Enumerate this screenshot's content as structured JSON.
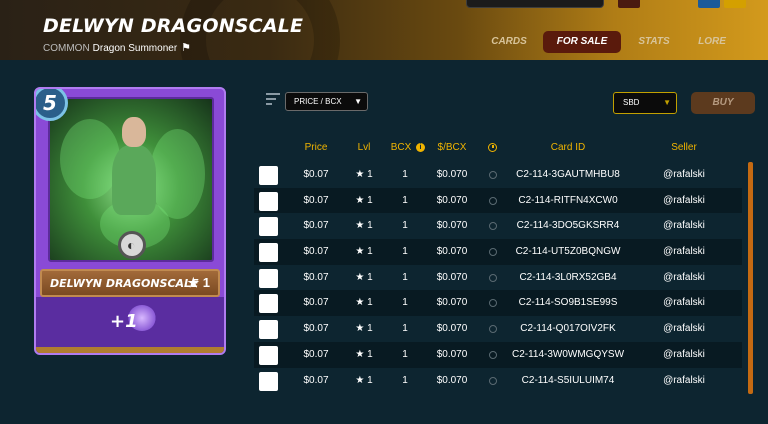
{
  "header": {
    "title": "DELWYN DRAGONSCALE",
    "rarity": "COMMON",
    "type": "Dragon Summoner",
    "tabs": [
      "CARDS",
      "FOR SALE",
      "STATS",
      "LORE"
    ],
    "active_tab": "FOR SALE"
  },
  "card": {
    "mana": "5",
    "name": "DELWYN DRAGONSCALE",
    "level_star": "★ 1",
    "ability": "+1"
  },
  "controls": {
    "sort_value": "PRICE / BCX",
    "currency_value": "SBD",
    "buy_label": "BUY"
  },
  "table": {
    "headers": {
      "price": "Price",
      "lvl": "Lvl",
      "bcx": "BCX",
      "per_bcx": "$/BCX",
      "card_id": "Card ID",
      "seller": "Seller"
    },
    "rows": [
      {
        "price": "$0.07",
        "lvl": "★ 1",
        "bcx": "1",
        "per_bcx": "$0.070",
        "card_id": "C2-114-3GAUTMHBU8",
        "seller": "@rafalski"
      },
      {
        "price": "$0.07",
        "lvl": "★ 1",
        "bcx": "1",
        "per_bcx": "$0.070",
        "card_id": "C2-114-RITFN4XCW0",
        "seller": "@rafalski"
      },
      {
        "price": "$0.07",
        "lvl": "★ 1",
        "bcx": "1",
        "per_bcx": "$0.070",
        "card_id": "C2-114-3DO5GKSRR4",
        "seller": "@rafalski"
      },
      {
        "price": "$0.07",
        "lvl": "★ 1",
        "bcx": "1",
        "per_bcx": "$0.070",
        "card_id": "C2-114-UT5Z0BQNGW",
        "seller": "@rafalski"
      },
      {
        "price": "$0.07",
        "lvl": "★ 1",
        "bcx": "1",
        "per_bcx": "$0.070",
        "card_id": "C2-114-3L0RX52GB4",
        "seller": "@rafalski"
      },
      {
        "price": "$0.07",
        "lvl": "★ 1",
        "bcx": "1",
        "per_bcx": "$0.070",
        "card_id": "C2-114-SO9B1SE99S",
        "seller": "@rafalski"
      },
      {
        "price": "$0.07",
        "lvl": "★ 1",
        "bcx": "1",
        "per_bcx": "$0.070",
        "card_id": "C2-114-Q017OIV2FK",
        "seller": "@rafalski"
      },
      {
        "price": "$0.07",
        "lvl": "★ 1",
        "bcx": "1",
        "per_bcx": "$0.070",
        "card_id": "C2-114-3W0WMGQYSW",
        "seller": "@rafalski"
      },
      {
        "price": "$0.07",
        "lvl": "★ 1",
        "bcx": "1",
        "per_bcx": "$0.070",
        "card_id": "C2-114-S5IULUIM74",
        "seller": "@rafalski"
      }
    ]
  },
  "colors": {
    "accent_gold": "#f0b400",
    "background": "#0d2530",
    "active_tab": "#5a1a0c",
    "card_purple": "#8a4ad6"
  },
  "icons": [
    "filter-icon",
    "info-icon",
    "clock-icon",
    "summoner-flag-icon"
  ]
}
